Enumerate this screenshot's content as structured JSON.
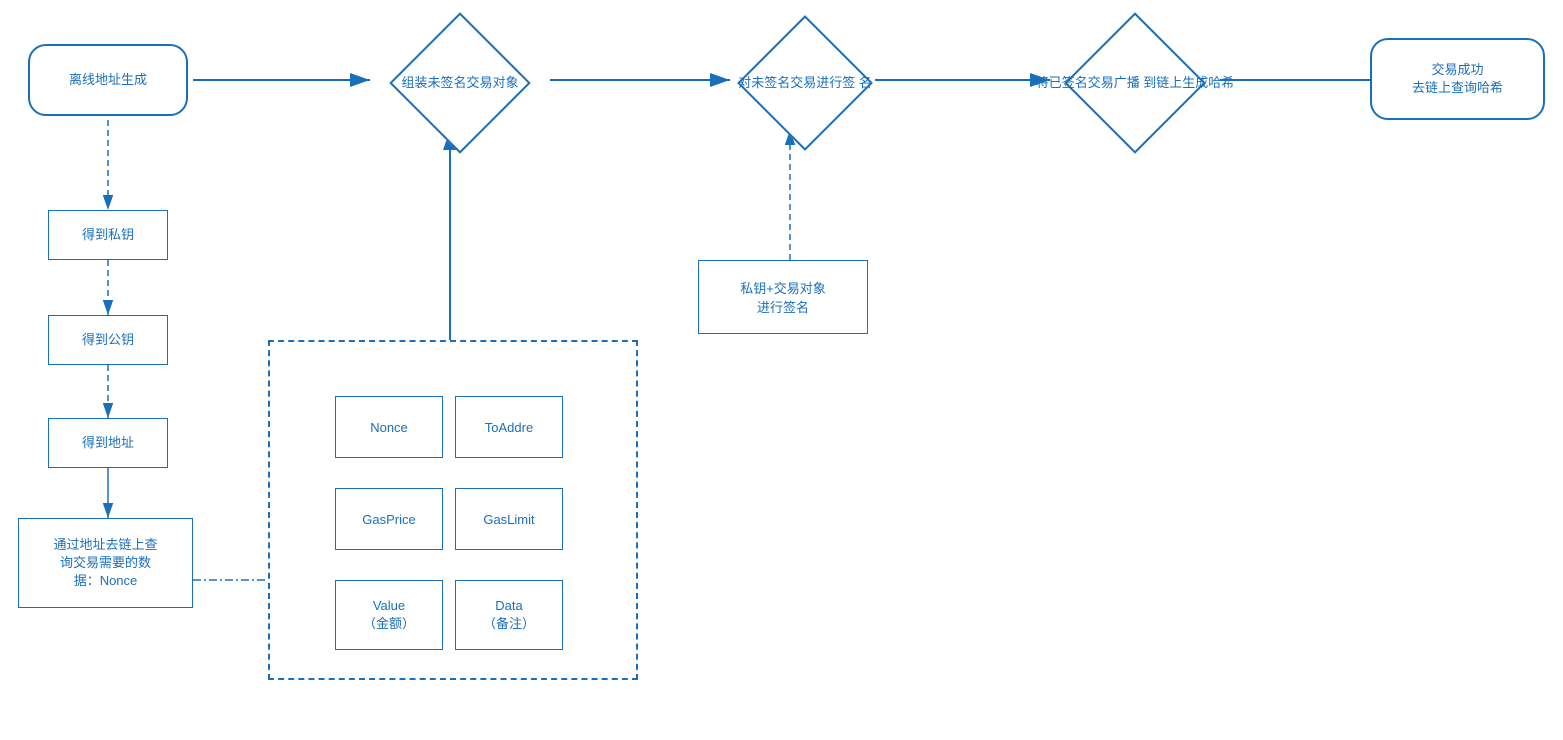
{
  "nodes": {
    "offline_addr": {
      "label": "离线地址生成"
    },
    "get_privkey": {
      "label": "得到私钥"
    },
    "get_pubkey": {
      "label": "得到公钥"
    },
    "get_address": {
      "label": "得到地址"
    },
    "query_nonce": {
      "label": "通过地址去链上查\n询交易需要的数\n据：Nonce"
    },
    "assemble_tx": {
      "label": "组装未签名交易对象"
    },
    "sign_tx": {
      "label": "对未签名交易进行签\n名"
    },
    "broadcast_tx": {
      "label": "将已签名交易广播\n到链上生成哈希"
    },
    "success": {
      "label": "交易成功\n去链上查询哈希"
    },
    "sign_action": {
      "label": "私钥+交易对象\n进行签名"
    },
    "nonce_field": {
      "label": "Nonce"
    },
    "to_addr_field": {
      "label": "ToAddre"
    },
    "gas_price_field": {
      "label": "GasPrice"
    },
    "gas_limit_field": {
      "label": "GasLimit"
    },
    "value_field": {
      "label": "Value\n（金额）"
    },
    "data_field": {
      "label": "Data\n（备注）"
    }
  },
  "colors": {
    "primary": "#1a6fba",
    "border": "#1a6fba",
    "bg": "#ffffff"
  }
}
